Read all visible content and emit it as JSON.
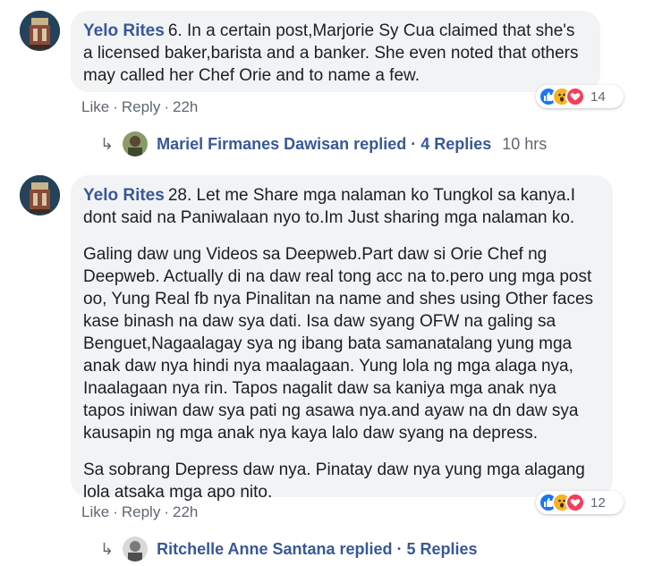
{
  "comments": [
    {
      "author": "Yelo Rites",
      "paragraphs": [
        "6. In a certain post,Marjorie Sy Cua claimed that she's a licensed baker,barista and a banker. She even noted that others may called her Chef Orie and to name a few."
      ],
      "actions": {
        "like": "Like",
        "reply": "Reply",
        "sep": "·",
        "time": "22h"
      },
      "reactions": {
        "icons": [
          "like-icon",
          "wow-icon",
          "love-icon"
        ],
        "count": "14"
      },
      "replies": {
        "arrow": "↳",
        "text": "Mariel Firmanes Dawisan replied · 4 Replies",
        "time": "10 hrs"
      }
    },
    {
      "author": "Yelo Rites",
      "paragraphs": [
        "28. Let me Share mga nalaman ko Tungkol sa kanya.I dont said na Paniwalaan nyo to.Im Just sharing mga nalaman ko.",
        "Galing daw ung Videos sa Deepweb.Part daw si Orie Chef ng Deepweb. Actually di na daw real tong acc na to.pero ung mga post oo, Yung Real fb nya Pinalitan na name and shes using Other faces kase binash na daw sya dati. Isa daw syang OFW na galing sa Benguet,Nagaalagay sya ng ibang bata samanatalang yung mga anak daw nya hindi nya maalagaan. Yung lola ng mga alaga nya, Inaalagaan nya rin. Tapos nagalit daw sa kaniya mga anak nya tapos iniwan daw sya pati ng asawa nya.and ayaw na dn daw sya kausapin ng mga anak nya kaya lalo daw syang na depress.",
        "Sa sobrang Depress daw nya. Pinatay daw nya yung mga alagang lola atsaka mga apo nito."
      ],
      "actions": {
        "like": "Like",
        "reply": "Reply",
        "sep": "·",
        "time": "22h"
      },
      "reactions": {
        "icons": [
          "like-icon",
          "wow-icon",
          "love-icon"
        ],
        "count": "12"
      },
      "replies": {
        "arrow": "↳",
        "text": "Ritchelle Anne Santana replied · 5 Replies",
        "time": ""
      }
    }
  ],
  "colors": {
    "link": "#385898",
    "meta": "#606770",
    "bubble": "#f2f3f5",
    "like": "#1877f2",
    "wow": "#f7b125",
    "love": "#f33e58"
  }
}
